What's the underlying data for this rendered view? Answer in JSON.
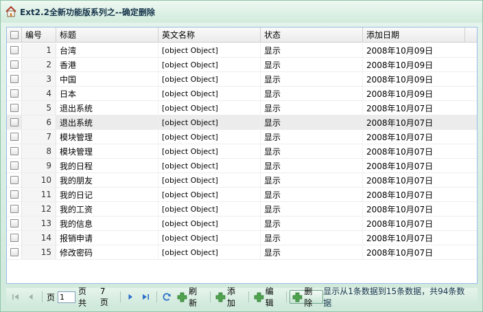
{
  "window": {
    "title": "Ext2.2全新功能版系列之--确定删除"
  },
  "grid": {
    "columns": {
      "no": "编号",
      "title": "标题",
      "en_name": "英文名称",
      "status": "状态",
      "date": "添加日期"
    },
    "rows": [
      {
        "no": "1",
        "title": "台湾",
        "en": "[object Object]",
        "status": "显示",
        "date": "2008年10月09日"
      },
      {
        "no": "2",
        "title": "香港",
        "en": "[object Object]",
        "status": "显示",
        "date": "2008年10月09日"
      },
      {
        "no": "3",
        "title": "中国",
        "en": "[object Object]",
        "status": "显示",
        "date": "2008年10月09日"
      },
      {
        "no": "4",
        "title": "日本",
        "en": "[object Object]",
        "status": "显示",
        "date": "2008年10月09日"
      },
      {
        "no": "5",
        "title": "退出系统",
        "en": "[object Object]",
        "status": "显示",
        "date": "2008年10月07日"
      },
      {
        "no": "6",
        "title": "退出系统",
        "en": "[object Object]",
        "status": "显示",
        "date": "2008年10月07日"
      },
      {
        "no": "7",
        "title": "模块管理",
        "en": "[object Object]",
        "status": "显示",
        "date": "2008年10月07日"
      },
      {
        "no": "8",
        "title": "模块管理",
        "en": "[object Object]",
        "status": "显示",
        "date": "2008年10月07日"
      },
      {
        "no": "9",
        "title": "我的日程",
        "en": "[object Object]",
        "status": "显示",
        "date": "2008年10月07日"
      },
      {
        "no": "10",
        "title": "我的朋友",
        "en": "[object Object]",
        "status": "显示",
        "date": "2008年10月07日"
      },
      {
        "no": "11",
        "title": "我的日记",
        "en": "[object Object]",
        "status": "显示",
        "date": "2008年10月07日"
      },
      {
        "no": "12",
        "title": "我的工资",
        "en": "[object Object]",
        "status": "显示",
        "date": "2008年10月07日"
      },
      {
        "no": "13",
        "title": "我的信息",
        "en": "[object Object]",
        "status": "显示",
        "date": "2008年10月07日"
      },
      {
        "no": "14",
        "title": "报销申请",
        "en": "[object Object]",
        "status": "显示",
        "date": "2008年10月07日"
      },
      {
        "no": "15",
        "title": "修改密码",
        "en": "[object Object]",
        "status": "显示",
        "date": "2008年10月07日"
      }
    ],
    "highlighted_row": 6
  },
  "pager": {
    "page_label": "页",
    "page_value": "1",
    "of_label": "页共",
    "total_pages": "7",
    "pages_suffix": "页",
    "refresh_label": "刷新",
    "add_label": "添加",
    "edit_label": "编辑",
    "delete_label": "删除",
    "display_msg": "显示从1条数据到15条数据，共94条数据"
  },
  "colors": {
    "accent_green": "#4fa34f",
    "nav_blue": "#2a6fc9",
    "frame": "#d6ede0"
  },
  "icons": {
    "title": "home-icon",
    "first": "first-page-icon",
    "prev": "prev-page-icon",
    "next": "next-page-icon",
    "last": "last-page-icon",
    "refresh": "refresh-icon",
    "add": "plus-icon"
  }
}
